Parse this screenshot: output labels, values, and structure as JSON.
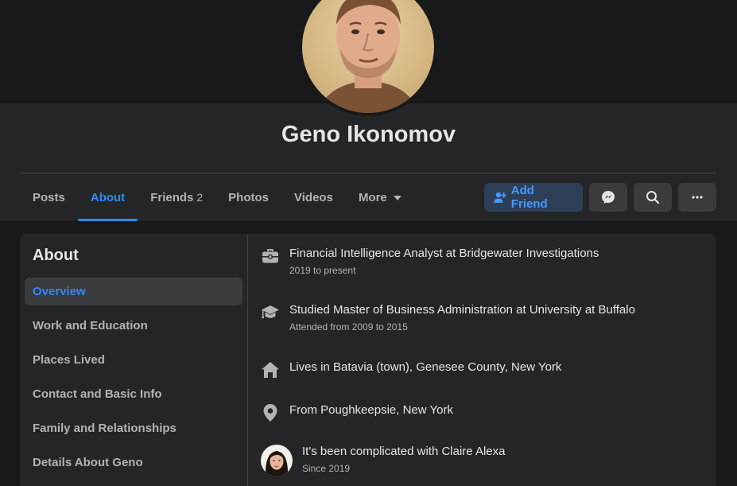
{
  "profile": {
    "name": "Geno Ikonomov"
  },
  "tabs": [
    {
      "label": "Posts"
    },
    {
      "label": "About"
    },
    {
      "label": "Friends",
      "count": "2"
    },
    {
      "label": "Photos"
    },
    {
      "label": "Videos"
    },
    {
      "label": "More"
    }
  ],
  "actions": {
    "add_friend_label": "Add Friend"
  },
  "about": {
    "title": "About",
    "sidebar": [
      {
        "label": "Overview"
      },
      {
        "label": "Work and Education"
      },
      {
        "label": "Places Lived"
      },
      {
        "label": "Contact and Basic Info"
      },
      {
        "label": "Family and Relationships"
      },
      {
        "label": "Details About Geno"
      }
    ],
    "items": [
      {
        "icon": "briefcase-icon",
        "main": "Financial Intelligence Analyst at Bridgewater Investigations",
        "sub": "2019 to present"
      },
      {
        "icon": "graduation-cap-icon",
        "main": "Studied Master of Business Administration at University at Buffalo",
        "sub": "Attended from 2009 to 2015"
      },
      {
        "icon": "home-icon",
        "main": "Lives in Batavia (town), Genesee County, New York"
      },
      {
        "icon": "location-pin-icon",
        "main": "From Poughkeepsie, New York"
      },
      {
        "icon": "partner-avatar",
        "main": "It's been complicated with Claire Alexa",
        "sub": "Since 2019"
      }
    ]
  },
  "colors": {
    "accent": "#2d88ff",
    "background": "#18191a",
    "surface": "#242526"
  }
}
